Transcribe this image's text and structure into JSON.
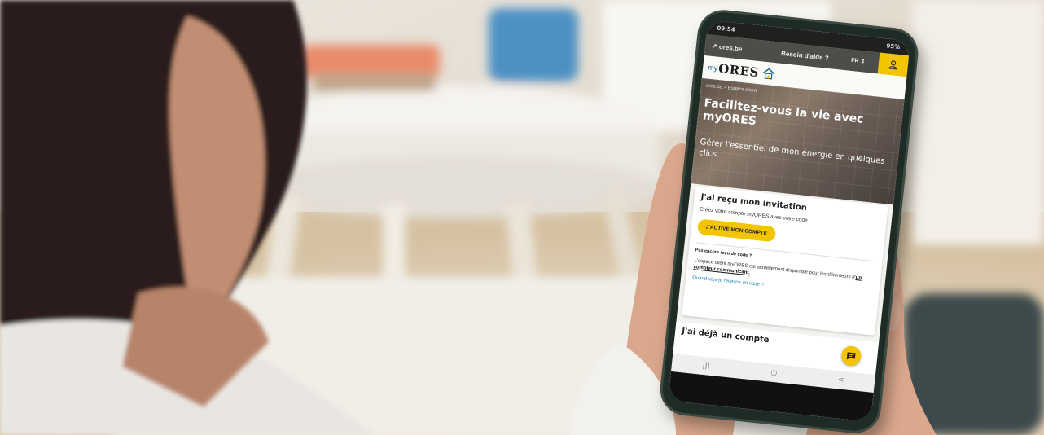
{
  "photo": {
    "subject": ""
  },
  "phone_screen": {
    "status": {
      "time": "09:54",
      "battery": "95%"
    },
    "topbar": {
      "home_link": "ores.be",
      "help": "Besoin d'aide ?",
      "lang": "FR"
    },
    "brand": {
      "my": "my",
      "name": "ORES"
    },
    "breadcrumb": "ores.be  >  Espace client",
    "hero": {
      "title": "Facilitez-vous la vie avec myORES",
      "subtitle": "Gérer l'essentiel de mon énergie en quelques clics."
    },
    "invitation": {
      "title": "J'ai reçu mon invitation",
      "text": "Créez votre compte myORES avec votre code",
      "button": "J'ACTIVE MON COMPTE"
    },
    "no_code": {
      "title": "Pas encore reçu de code ?",
      "text": "L'espace client myORES est actuellement disponible pour les détenteurs d'",
      "text_link": "un compteur communicant.",
      "link": "Quand vais-je recevoir un code ?"
    },
    "account": {
      "title": "J'ai déjà un compte"
    },
    "navbar": {
      "recent": "|||",
      "home": "○",
      "back": "<"
    }
  },
  "colors": {
    "accent": "#f2c500",
    "topbar": "#4d4d4a",
    "link": "#1c84c6",
    "frame": "#1f2b25"
  },
  "icons": [
    "external-link-icon",
    "user-icon",
    "house-logo-icon",
    "chat-icon"
  ]
}
